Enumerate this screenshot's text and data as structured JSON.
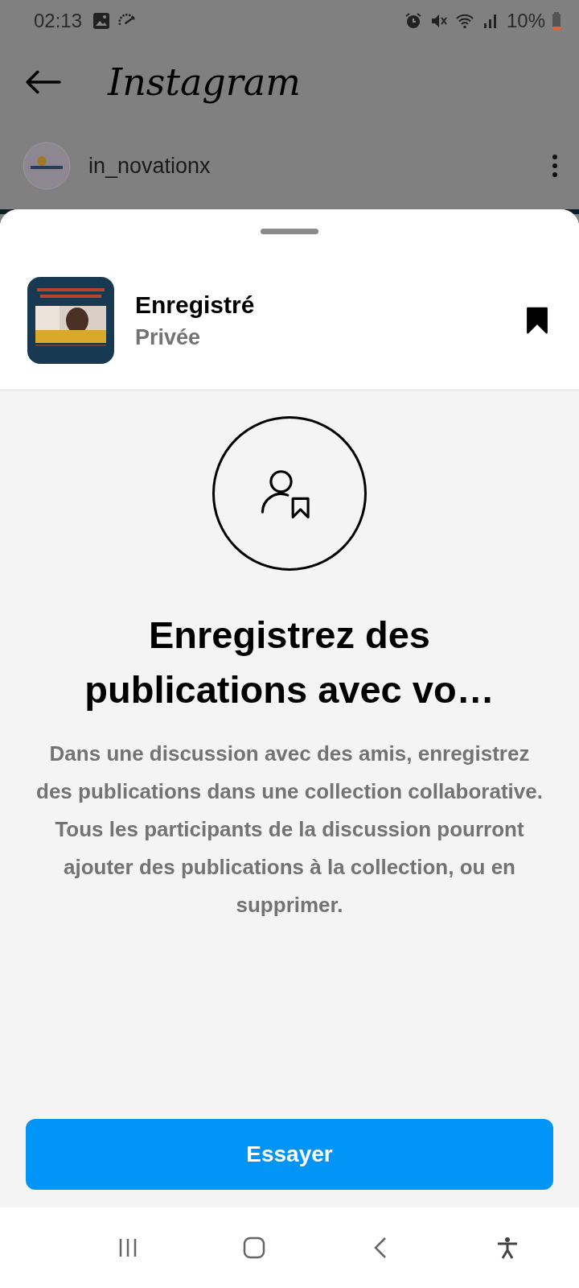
{
  "status_bar": {
    "time": "02:13",
    "battery": "10%"
  },
  "header": {
    "logo": "Instagram"
  },
  "post": {
    "username": "in_novationx"
  },
  "sheet": {
    "collection": {
      "title": "Enregistré",
      "privacy": "Privée",
      "saved": true
    },
    "empty_state": {
      "title": "Enregistrez des publications avec vo…",
      "description": "Dans une discussion avec des amis, enregistrez des publications dans une collection collaborative. Tous les participants de la discussion pourront ajouter des publications à la collection, ou en supprimer."
    },
    "button": "Essayer"
  }
}
